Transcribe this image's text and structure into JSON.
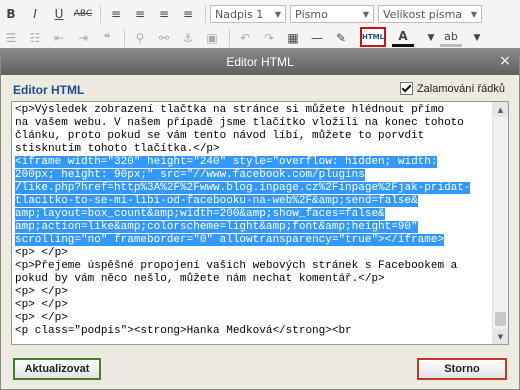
{
  "toolbar": {
    "row1": {
      "bold": "B",
      "italic": "I",
      "underline": "U",
      "strike": "ABC",
      "align_glyphs": [
        "≡",
        "≡",
        "≡",
        "≡"
      ]
    },
    "dropdowns": {
      "format": "Nadpis 1",
      "font": "Písmo",
      "size": "Velikost písma"
    },
    "html_button": "HTML",
    "text_color_label": "A",
    "highlight_label": "ab"
  },
  "dialog": {
    "title": "Editor HTML",
    "close_label": "×",
    "heading": "Editor HTML",
    "wrap_label": "Zalamování řádků",
    "wrap_checked": true,
    "code_lines": [
      {
        "text": "<p>Výsledek zobrazení tlačtka na stránce si můžete hlédnout přímo",
        "selected": false
      },
      {
        "text": "na vašem webu. V našem případě jsme tlačítko vložili na konec tohoto",
        "selected": false
      },
      {
        "text": "článku, proto pokud se vám tento návod líbí, můžete to porvdit",
        "selected": false
      },
      {
        "text": "stisknutím tohoto tlačítka.</p>",
        "selected": false
      },
      {
        "text": "<iframe width=\"320\" height=\"240\" style=\"overflow: hidden; width:",
        "selected": true
      },
      {
        "text": "200px; height: 90px;\" src=\"//www.facebook.com/plugins",
        "selected": true
      },
      {
        "text": "/like.php?href=http%3A%2F%2Fwww.blog.inpage.cz%2Finpage%2Fjak-pridat-",
        "selected": true
      },
      {
        "text": "tlacitko-to-se-mi-libi-od-facebooku-na-web%2F&amp;send=false&",
        "selected": true
      },
      {
        "text": "amp;layout=box_count&amp;width=200&amp;show_faces=false&",
        "selected": true
      },
      {
        "text": "amp;action=like&amp;colorscheme=light&amp;font&amp;height=90\"",
        "selected": true
      },
      {
        "text": "scrolling=\"no\" frameborder=\"0\" allowtransparency=\"true\"></iframe>",
        "selected": true
      },
      {
        "text": "<p> </p>",
        "selected": false
      },
      {
        "text": "<p>Přejeme úspěšné propojení vašich webových stránek s Facebookem a",
        "selected": false
      },
      {
        "text": "pokud by vám něco nešlo, můžete nám nechat komentář.</p>",
        "selected": false
      },
      {
        "text": "<p> </p>",
        "selected": false
      },
      {
        "text": "<p> </p>",
        "selected": false
      },
      {
        "text": "<p> </p>",
        "selected": false
      },
      {
        "text": "<p class=\"podpis\"><strong>Hanka Medková</strong><br",
        "selected": false
      }
    ],
    "update_button": "Aktualizovat",
    "cancel_button": "Storno"
  },
  "colors": {
    "accent": "#1e4e8c",
    "selection": "#3399ff",
    "highlight_border": "#cc1111"
  }
}
